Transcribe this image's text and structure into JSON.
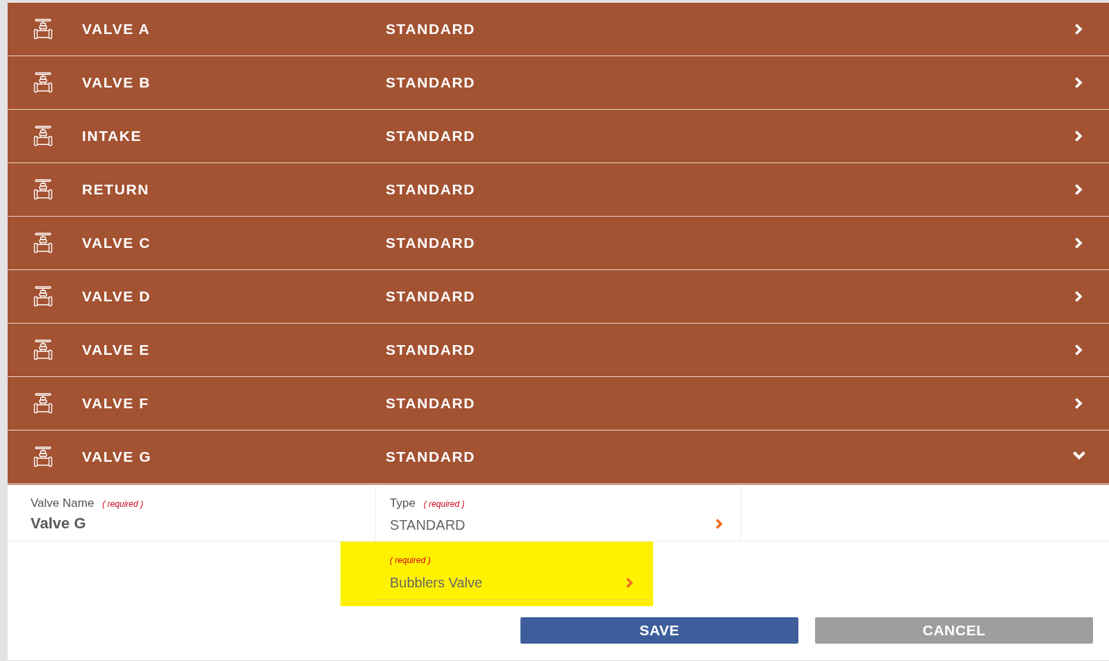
{
  "valves": [
    {
      "name": "VALVE A",
      "type": "STANDARD",
      "expanded": false
    },
    {
      "name": "VALVE B",
      "type": "STANDARD",
      "expanded": false
    },
    {
      "name": "INTAKE",
      "type": "STANDARD",
      "expanded": false
    },
    {
      "name": "RETURN",
      "type": "STANDARD",
      "expanded": false
    },
    {
      "name": "VALVE C",
      "type": "STANDARD",
      "expanded": false
    },
    {
      "name": "VALVE D",
      "type": "STANDARD",
      "expanded": false
    },
    {
      "name": "VALVE E",
      "type": "STANDARD",
      "expanded": false
    },
    {
      "name": "VALVE F",
      "type": "STANDARD",
      "expanded": false
    },
    {
      "name": "VALVE G",
      "type": "STANDARD",
      "expanded": true
    }
  ],
  "editor": {
    "fields": [
      {
        "kind": "text",
        "label": "Valve Name",
        "required_note": "( required )",
        "value": "Valve G"
      },
      {
        "kind": "select",
        "label": "Type",
        "required_note": "( required )",
        "value": "STANDARD"
      }
    ],
    "subfield": {
      "kind": "select",
      "required_note": "( required )",
      "value": "Bubblers Valve",
      "highlighted": true
    }
  },
  "buttons": [
    {
      "kind": "primary",
      "label": "SAVE"
    },
    {
      "kind": "secondary",
      "label": "CANCEL"
    }
  ]
}
